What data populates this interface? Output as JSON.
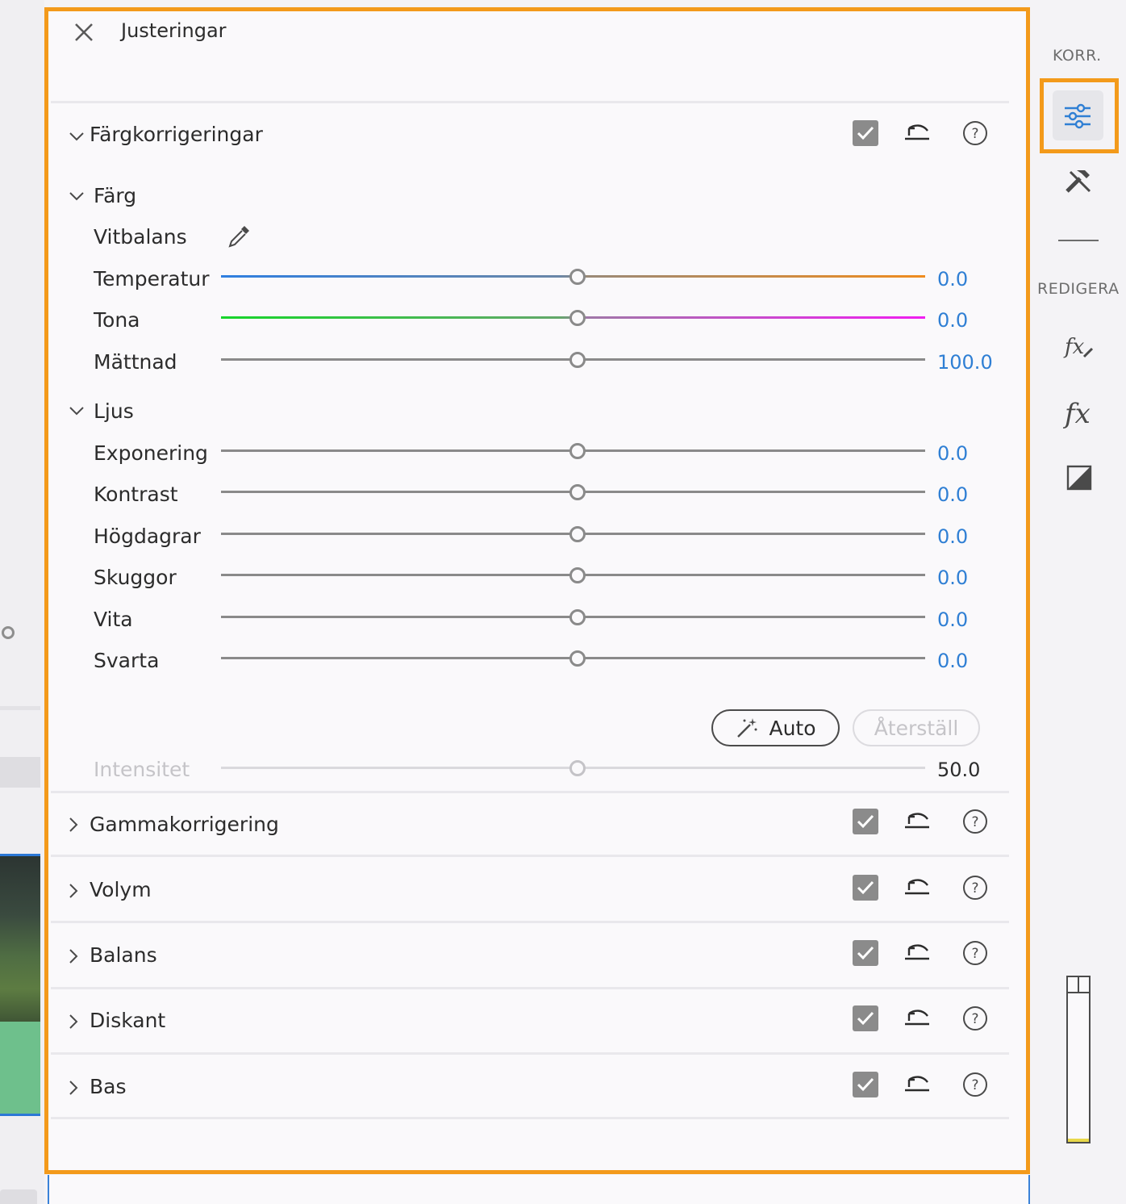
{
  "panel": {
    "title": "Justeringar"
  },
  "color_correction": {
    "title": "Färgkorrigeringar",
    "color_group": {
      "title": "Färg",
      "white_balance_label": "Vitbalans",
      "sliders": [
        {
          "label": "Temperatur",
          "value": "0.0",
          "position": 0.5
        },
        {
          "label": "Tona",
          "value": "0.0",
          "position": 0.5
        },
        {
          "label": "Mättnad",
          "value": "100.0",
          "position": 0.5
        }
      ]
    },
    "light_group": {
      "title": "Ljus",
      "sliders": [
        {
          "label": "Exponering",
          "value": "0.0",
          "position": 0.5
        },
        {
          "label": "Kontrast",
          "value": "0.0",
          "position": 0.5
        },
        {
          "label": "Högdagrar",
          "value": "0.0",
          "position": 0.5
        },
        {
          "label": "Skuggor",
          "value": "0.0",
          "position": 0.5
        },
        {
          "label": "Vita",
          "value": "0.0",
          "position": 0.5
        },
        {
          "label": "Svarta",
          "value": "0.0",
          "position": 0.5
        }
      ]
    },
    "auto_label": "Auto",
    "reset_label": "Återställ",
    "intensity": {
      "label": "Intensitet",
      "value": "50.0",
      "position": 0.5
    }
  },
  "sections": [
    {
      "title": "Gammakorrigering"
    },
    {
      "title": "Volym"
    },
    {
      "title": "Balans"
    },
    {
      "title": "Diskant"
    },
    {
      "title": "Bas"
    }
  ],
  "rail": {
    "top_label": "KORR.",
    "edit_label": "REDIGERA"
  },
  "colors": {
    "accent_orange": "#f39a1b",
    "value_blue": "#2f7fd4",
    "temperature_cold": "#2f7fe0",
    "temperature_warm": "#f08c1e",
    "tint_green": "#16d52a",
    "tint_magenta": "#f01ef0"
  },
  "icons": {
    "close": "close-icon",
    "checkbox": "checkbox-checked-icon",
    "reset": "undo-icon",
    "help": "help-icon",
    "eyedropper": "eyedropper-icon",
    "magic": "magic-wand-icon"
  }
}
